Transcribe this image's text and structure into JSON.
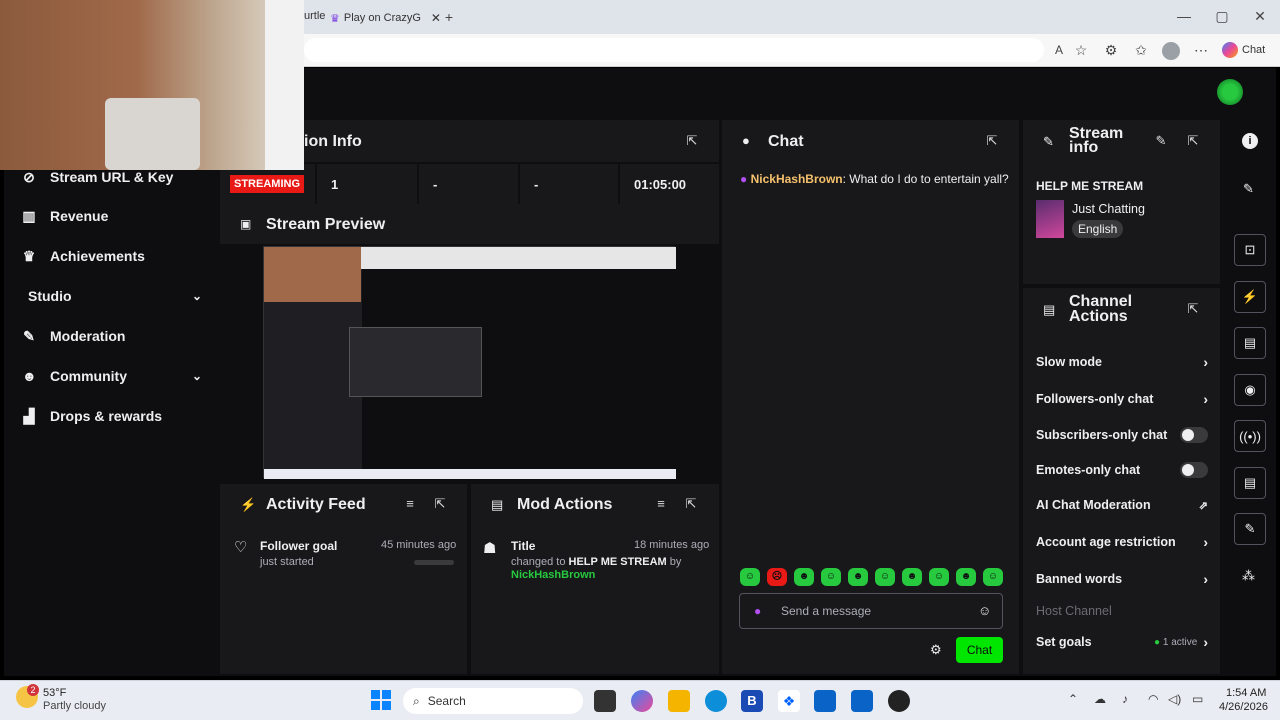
{
  "browser": {
    "tabs": [
      {
        "label": "urtle"
      },
      {
        "label": "Play on CrazyG"
      }
    ],
    "new_tab_icon": "plus-icon",
    "copilot_label": "Chat",
    "window_controls": [
      "minimize",
      "maximize",
      "close"
    ]
  },
  "sidebar": {
    "items": [
      {
        "label": "Stream URL & Key",
        "icon": "link-icon"
      },
      {
        "label": "Revenue",
        "icon": "bar-chart-icon"
      },
      {
        "label": "Achievements",
        "icon": "trophy-icon"
      },
      {
        "label": "Studio",
        "icon": "camera-icon",
        "expandable": true
      },
      {
        "label": "Moderation",
        "icon": "wrench-icon"
      },
      {
        "label": "Community",
        "icon": "people-icon",
        "expandable": true
      },
      {
        "label": "Drops & rewards",
        "icon": "gift-icon"
      }
    ]
  },
  "session": {
    "title_partial": "ion Info",
    "status_badge": "STREAMING",
    "stats": [
      "1",
      "-",
      "-",
      "01:05:00"
    ]
  },
  "preview": {
    "title": "Stream Preview"
  },
  "activity_feed": {
    "title": "Activity Feed",
    "item": {
      "title": "Follower goal",
      "sub": "just started",
      "time": "45 minutes ago"
    }
  },
  "mod_actions": {
    "title": "Mod Actions",
    "item": {
      "title": "Title",
      "time": "18 minutes ago",
      "line1_pre": "changed to",
      "line1_bold": "HELP ME STREAM",
      "line1_post": "by",
      "user": "NickHashBrown"
    }
  },
  "chat": {
    "title": "Chat",
    "messages": [
      {
        "user": "NickHashBrown",
        "text": ": What do I do to entertain yall?"
      }
    ],
    "input_placeholder": "Send a message",
    "send_label": "Chat",
    "user_color": "#f5c16c",
    "accent": "#00e600"
  },
  "stream_info": {
    "title": "Stream info",
    "stream_title": "HELP ME STREAM",
    "category": "Just Chatting",
    "tag": "English"
  },
  "channel_actions": {
    "title": "Channel Actions",
    "items": [
      {
        "label": "Slow mode",
        "control": "chevron"
      },
      {
        "label": "Followers-only chat",
        "control": "chevron"
      },
      {
        "label": "Subscribers-only chat",
        "control": "toggle"
      },
      {
        "label": "Emotes-only chat",
        "control": "toggle"
      },
      {
        "label": "AI Chat Moderation",
        "control": "external"
      },
      {
        "label": "Account age restriction",
        "control": "chevron"
      },
      {
        "label": "Banned words",
        "control": "chevron"
      },
      {
        "label": "Host Channel",
        "control": "none",
        "disabled": true
      },
      {
        "label": "Set goals",
        "control": "chevron",
        "status": "1 active"
      }
    ]
  },
  "taskbar": {
    "weather_temp": "53°F",
    "weather_desc": "Partly cloudy",
    "weather_badge": "2",
    "search_label": "Search",
    "time": "1:54 AM",
    "date": "4/26/2026"
  }
}
